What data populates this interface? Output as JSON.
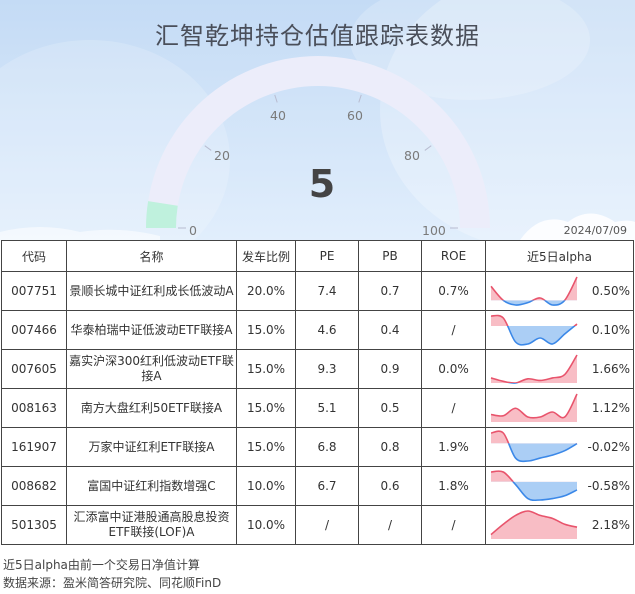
{
  "header": {
    "title": "汇智乾坤持仓估值跟踪表数据",
    "gauge_value": "5",
    "gauge_level": 5,
    "gauge_max": 100,
    "gauge_ticks": [
      "0",
      "20",
      "40",
      "60",
      "80",
      "100"
    ],
    "date": "2024/07/09"
  },
  "table": {
    "columns": [
      "代码",
      "名称",
      "发车比例",
      "PE",
      "PB",
      "ROE",
      "近5日alpha"
    ],
    "rows": [
      {
        "code": "007751",
        "name": "景顺长城中证红利成长低波动A",
        "ratio": "20.0%",
        "pe": "7.4",
        "pb": "0.7",
        "roe": "0.7%",
        "alpha": "0.50%",
        "trend": [
          0.3,
          0.0,
          -0.1,
          -0.05,
          0.05,
          -0.1,
          0.0,
          0.5
        ]
      },
      {
        "code": "007466",
        "name": "华泰柏瑞中证低波动ETF联接A",
        "ratio": "15.0%",
        "pe": "4.6",
        "pb": "0.4",
        "roe": "/",
        "alpha": "0.10%",
        "trend": [
          0.5,
          0.4,
          -0.8,
          -0.9,
          -0.6,
          -0.9,
          -0.4,
          0.1
        ]
      },
      {
        "code": "007605",
        "name": "嘉实沪深300红利低波动ETF联接A",
        "ratio": "15.0%",
        "pe": "9.3",
        "pb": "0.9",
        "roe": "0.0%",
        "alpha": "1.66%",
        "trend": [
          0.3,
          0.1,
          0.0,
          0.25,
          0.15,
          0.3,
          0.5,
          1.66
        ]
      },
      {
        "code": "008163",
        "name": "南方大盘红利50ETF联接A",
        "ratio": "15.0%",
        "pe": "5.1",
        "pb": "0.5",
        "roe": "/",
        "alpha": "1.12%",
        "trend": [
          0.3,
          0.25,
          0.55,
          0.2,
          0.2,
          0.4,
          0.2,
          1.12
        ]
      },
      {
        "code": "161907",
        "name": "万家中证红利ETF联接A",
        "ratio": "15.0%",
        "pe": "6.8",
        "pb": "0.8",
        "roe": "1.9%",
        "alpha": "-0.02%",
        "trend": [
          0.7,
          0.7,
          -1.0,
          -1.2,
          -1.0,
          -0.8,
          -0.5,
          -0.02
        ]
      },
      {
        "code": "008682",
        "name": "富国中证红利指数增强C",
        "ratio": "10.0%",
        "pe": "6.7",
        "pb": "0.6",
        "roe": "1.8%",
        "alpha": "-0.58%",
        "trend": [
          0.7,
          0.7,
          -0.2,
          -1.2,
          -1.3,
          -1.2,
          -1.0,
          -0.58
        ]
      },
      {
        "code": "501305",
        "name": "汇添富中证港股通高股息投资ETF联接(LOF)A",
        "ratio": "10.0%",
        "pe": "/",
        "pb": "/",
        "roe": "/",
        "alpha": "2.18%",
        "trend": [
          0.3,
          1.0,
          1.6,
          1.9,
          1.6,
          1.4,
          1.0,
          0.8
        ]
      }
    ]
  },
  "footer": {
    "note1": "近5日alpha由前一个交易日净值计算",
    "note2": "数据来源：盈米简答研究院、同花顺FinD"
  },
  "colors": {
    "positive_line": "#e8546c",
    "positive_fill": "#f6a7b2",
    "negative_line": "#3b88e8",
    "negative_fill": "#8fbdf2",
    "gauge_track": "#ecedfa",
    "gauge_fill": "#bff1dd",
    "sky_top": "#bcd6f4",
    "sky_bottom": "#dcebfb"
  }
}
